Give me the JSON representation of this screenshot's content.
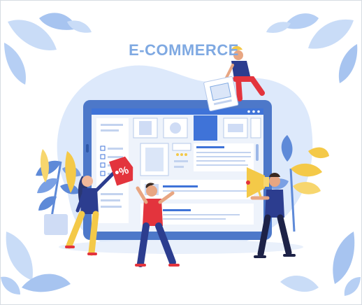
{
  "heading": "E-COMMERCE",
  "tag_symbol": "%",
  "colors": {
    "blob": "#dde9fb",
    "monitor": "#4d78c9",
    "screen": "#eef3fb",
    "accent_blue": "#3f73d8",
    "leaf_light": "#c9dcf7",
    "leaf_mid": "#a7c4f0",
    "yellow": "#f4c948",
    "red": "#e3343d",
    "navy": "#2a3773"
  },
  "icons": [
    "leaf-decoration",
    "price-tag-icon",
    "megaphone-icon",
    "product-card-icon"
  ]
}
